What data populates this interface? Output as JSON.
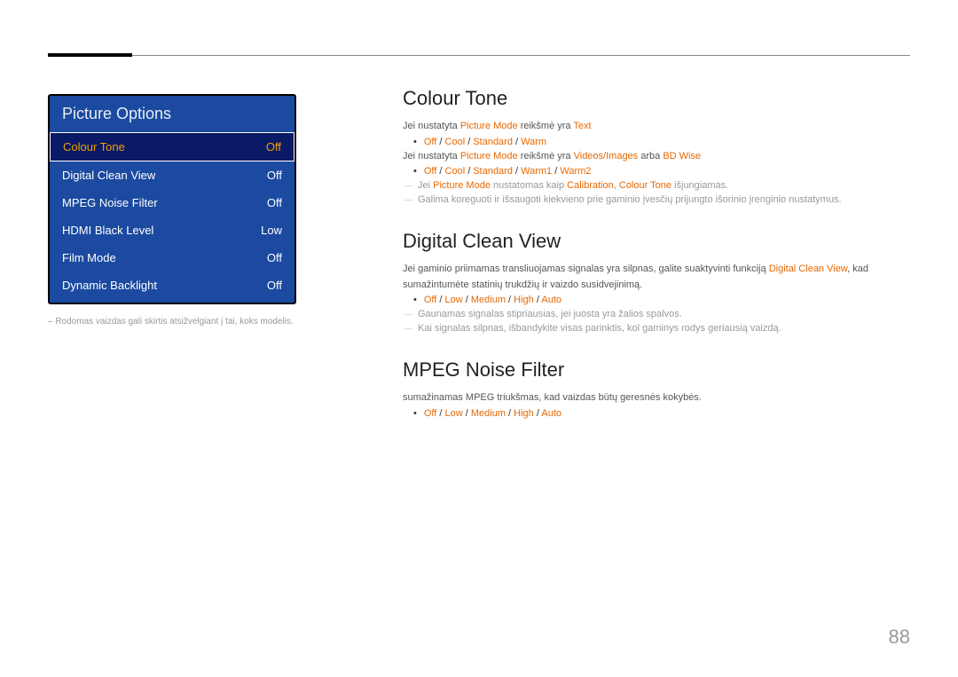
{
  "menu": {
    "title": "Picture Options",
    "items": [
      {
        "label": "Colour Tone",
        "value": "Off",
        "selected": true
      },
      {
        "label": "Digital Clean View",
        "value": "Off"
      },
      {
        "label": "MPEG Noise Filter",
        "value": "Off"
      },
      {
        "label": "HDMI Black Level",
        "value": "Low"
      },
      {
        "label": "Film Mode",
        "value": "Off"
      },
      {
        "label": "Dynamic Backlight",
        "value": "Off"
      }
    ],
    "note": "– Rodomas vaizdas gali skirtis atsižvelgiant į tai, koks modelis."
  },
  "sections": {
    "colourTone": {
      "heading": "Colour Tone",
      "line1_a": "Jei nustatyta ",
      "line1_b": "Picture Mode",
      "line1_c": " reikšmė yra ",
      "line1_d": "Text",
      "bullet1_parts": [
        "Off",
        " / ",
        "Cool",
        " / ",
        "Standard",
        " / ",
        "Warm"
      ],
      "line2_a": "Jei nustatyta ",
      "line2_b": "Picture Mode",
      "line2_c": " reikšmė yra ",
      "line2_d": "Videos/Images",
      "line2_e": " arba ",
      "line2_f": "BD Wise",
      "bullet2_parts": [
        "Off",
        " / ",
        "Cool",
        " / ",
        "Standard",
        " / ",
        "Warm1",
        " / ",
        "Warm2"
      ],
      "note1_a": "Jei ",
      "note1_b": "Picture Mode",
      "note1_c": " nustatomas kaip ",
      "note1_d": "Calibration",
      "note1_e": ", ",
      "note1_f": "Colour Tone",
      "note1_g": " išjungiamas.",
      "note2": "Galima koreguoti ir išsaugoti kiekvieno prie gaminio įvesčių prijungto išorinio įrenginio nustatymus."
    },
    "dcv": {
      "heading": "Digital Clean View",
      "line1_a": "Jei gaminio priimamas transliuojamas signalas yra silpnas, galite suaktyvinti funkciją ",
      "line1_b": "Digital Clean View",
      "line1_c": ", kad sumažintumėte statinių trukdžių ir vaizdo susidvejinimą.",
      "bullet_parts": [
        "Off",
        " / ",
        "Low",
        " / ",
        "Medium",
        " / ",
        "High",
        " / ",
        "Auto"
      ],
      "note1": "Gaunamas signalas stipriausias, jei juosta yra žalios spalvos.",
      "note2": "Kai signalas silpnas, išbandykite visas parinktis, kol gaminys rodys geriausią vaizdą."
    },
    "mpeg": {
      "heading": "MPEG Noise Filter",
      "line1": "sumažinamas MPEG triukšmas, kad vaizdas būtų geresnės kokybės.",
      "bullet_parts": [
        "Off",
        " / ",
        "Low",
        " / ",
        "Medium",
        " / ",
        "High",
        " / ",
        "Auto"
      ]
    }
  },
  "pageNumber": "88"
}
